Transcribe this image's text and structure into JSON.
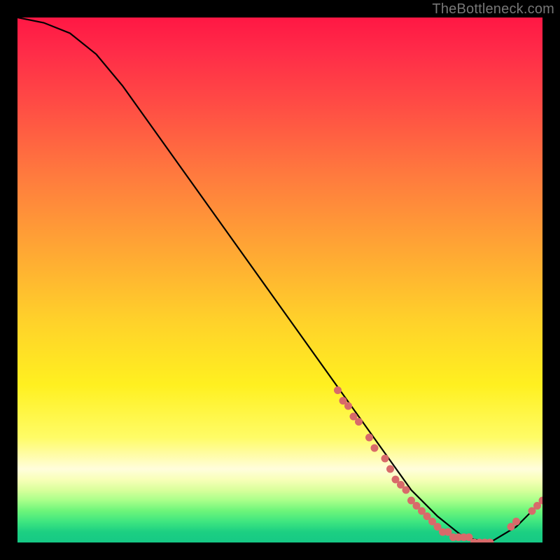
{
  "watermark": "TheBottleneck.com",
  "chart_data": {
    "type": "line",
    "title": "",
    "xlabel": "",
    "ylabel": "",
    "xlim": [
      0,
      100
    ],
    "ylim": [
      0,
      100
    ],
    "series": [
      {
        "name": "curve",
        "x": [
          0,
          5,
          10,
          15,
          20,
          25,
          30,
          35,
          40,
          45,
          50,
          55,
          60,
          65,
          70,
          75,
          80,
          85,
          90,
          95,
          100
        ],
        "values": [
          100,
          99,
          97,
          93,
          87,
          80,
          73,
          66,
          59,
          52,
          45,
          38,
          31,
          24,
          17,
          10,
          5,
          1,
          0,
          3,
          8
        ]
      }
    ],
    "markers": {
      "name": "dots",
      "x": [
        61,
        62,
        63,
        64,
        65,
        67,
        68,
        70,
        71,
        72,
        73,
        74,
        75,
        76,
        77,
        78,
        79,
        80,
        81,
        82,
        83,
        84,
        85,
        86,
        87,
        88,
        89,
        90,
        94,
        95,
        98,
        99,
        100
      ],
      "values": [
        29,
        27,
        26,
        24,
        23,
        20,
        18,
        16,
        14,
        12,
        11,
        10,
        8,
        7,
        6,
        5,
        4,
        3,
        2,
        2,
        1,
        1,
        1,
        1,
        0,
        0,
        0,
        0,
        3,
        4,
        6,
        7,
        8
      ]
    },
    "background_gradient": {
      "top": "#ff1744",
      "mid": "#ffd22a",
      "bottom": "#16c985"
    }
  }
}
